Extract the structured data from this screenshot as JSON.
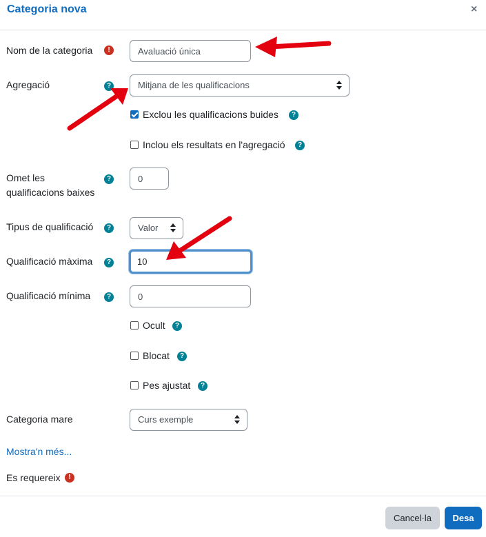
{
  "dialog": {
    "title": "Categoria nova",
    "close_glyph": "×"
  },
  "fields": {
    "name": {
      "label": "Nom de la categoria",
      "value": "Avaluació única",
      "required": true
    },
    "aggregation": {
      "label": "Agregació",
      "selected": "Mitjana de les qualificacions"
    },
    "exclude_empty": {
      "label": "Exclou les qualificacions buides",
      "checked": true
    },
    "include_outcomes": {
      "label": "Inclou els resultats en l'agregació",
      "checked": false
    },
    "drop_lowest": {
      "label_line1": "Omet les",
      "label_line2": "qualificacions baixes",
      "value": "0"
    },
    "grade_type": {
      "label": "Tipus de qualificació",
      "selected": "Valor"
    },
    "max_grade": {
      "label": "Qualificació màxima",
      "value": "10"
    },
    "min_grade": {
      "label": "Qualificació mínima",
      "value": "0"
    },
    "hidden": {
      "label": "Ocult",
      "checked": false
    },
    "locked": {
      "label": "Blocat",
      "checked": false
    },
    "weight_adjusted": {
      "label": "Pes ajustat",
      "checked": false
    },
    "parent_category": {
      "label": "Categoria mare",
      "selected": "Curs exemple"
    }
  },
  "show_more": "Mostra'n més...",
  "required_note": "Es requereix",
  "buttons": {
    "cancel": "Cancel·la",
    "save": "Desa"
  },
  "icons": {
    "help": "help-icon",
    "required": "required-icon"
  },
  "colors": {
    "accent": "#0f6cbf",
    "help": "#008196",
    "required": "#ca3120",
    "annotation_arrow": "#e3000f"
  }
}
